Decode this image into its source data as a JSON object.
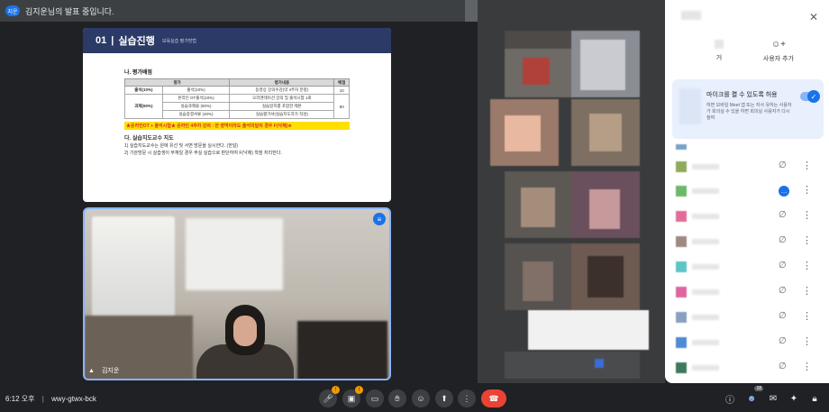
{
  "presentation_banner": {
    "chip": "지운",
    "text": "김지운님의 발표 중입니다."
  },
  "slide": {
    "number": "01",
    "title": "실습진행",
    "subtitle": "보육실습 평가방법",
    "section_eval": "나. 평가배점",
    "table_headers": [
      "평가",
      "평가내용",
      "배점"
    ],
    "rows": [
      {
        "cat": "출석(10%)",
        "item": "출석(10%)",
        "desc": "동영상 강의수강(약 4주차 분량)",
        "score": "10"
      },
      {
        "cat": "",
        "item": "온라인 OT출석(10%)",
        "desc": "오리엔테이션 강의 및 출석시험 1회",
        "score": ""
      },
      {
        "cat": "과제(90%)",
        "item": "실습과제물 (50%)",
        "desc": "실습일지를 포함한 제본",
        "score": "90"
      },
      {
        "cat": "",
        "item": "실습종결서류 (40%)",
        "desc": "실습평가서(실습지도자가 작성)",
        "score": ""
      }
    ],
    "notice": "★온라인OT + 출석시험★ 온라인 4주차 강의 : 한 영역이라도 출석미달의 경우 F(낙제)★",
    "section_guide": "다. 실습지도교수 지도",
    "guide_lines": [
      "1) 실습지도교수는 원에 유선 및 서면 방문을 실시한다. (한달)",
      "2) 기관방문 시 실습생이 부재일 경우 부실 실습으로 판단하여 F(낙제) 학점 처리한다."
    ]
  },
  "video": {
    "name": "김지운"
  },
  "panel": {
    "add_user_label": "사용자 추가",
    "left_label": "거",
    "mic_toggle_title": "마이크를 켤 수 있도록 허용",
    "mic_toggle_desc": "하면 모바일 Meet 앱 또는 자사 유하는 사용자가 회의실 수 있을 하면 회의실 사용자가 다시 참여"
  },
  "bottom": {
    "time": "6:12 오후",
    "meeting_code": "wwy-gtwx-bck",
    "participants_badge": "18"
  },
  "colors": {
    "accent": "#1a73e8",
    "end_call": "#ea4335",
    "slide_header": "#2b3a67",
    "notice_bg": "#ffe000"
  }
}
